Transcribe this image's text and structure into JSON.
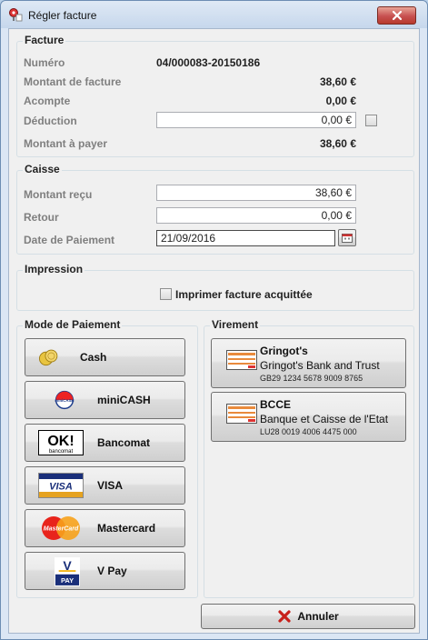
{
  "window": {
    "title": "Régler facture"
  },
  "facture": {
    "title": "Facture",
    "numero_label": "Numéro",
    "numero_value": "04/000083-20150186",
    "montant_label": "Montant de facture",
    "montant_value": "38,60 €",
    "acompte_label": "Acompte",
    "acompte_value": "0,00 €",
    "deduction_label": "Déduction",
    "deduction_value": "0,00 €",
    "apayer_label": "Montant à payer",
    "apayer_value": "38,60 €"
  },
  "caisse": {
    "title": "Caisse",
    "recu_label": "Montant reçu",
    "recu_value": "38,60 €",
    "retour_label": "Retour",
    "retour_value": "0,00 €",
    "date_label": "Date de Paiement",
    "date_value": "21/09/2016"
  },
  "impression": {
    "title": "Impression",
    "checkbox_label": "Imprimer facture acquittée"
  },
  "mode_paiement": {
    "title": "Mode de Paiement",
    "buttons": [
      "Cash",
      "miniCASH",
      "Bancomat",
      "VISA",
      "Mastercard",
      "V Pay"
    ]
  },
  "virement": {
    "title": "Virement",
    "banks": [
      {
        "short": "Gringot's",
        "name": "Gringot's Bank and Trust",
        "iban": "GB29 1234 5678 9009 8765"
      },
      {
        "short": "BCCE",
        "name": "Banque et Caisse de l'Etat",
        "iban": "LU28 0019 4006 4475 000"
      }
    ]
  },
  "footer": {
    "cancel_label": "Annuler"
  },
  "icon_text": {
    "minicash": "miniCASH",
    "bancomat_big": "OK!",
    "bancomat_small": "bancomat",
    "visa": "VISA",
    "mastercard": "MasterCard",
    "vpay_v": "V",
    "vpay_pay": "PAY"
  },
  "icons": {
    "title": "invoice-pin-icon",
    "close": "close-icon",
    "calendar": "calendar-icon",
    "cash": "coins-icon",
    "minicash": "minicash-icon",
    "bancomat": "bancomat-icon",
    "visa": "visa-icon",
    "mastercard": "mastercard-icon",
    "vpay": "vpay-icon",
    "bank": "bank-transfer-icon",
    "cancel": "red-x-icon"
  },
  "colors": {
    "accent": "#c75050",
    "window_border": "#6d8db3",
    "label_gray": "#7f7f7f"
  }
}
